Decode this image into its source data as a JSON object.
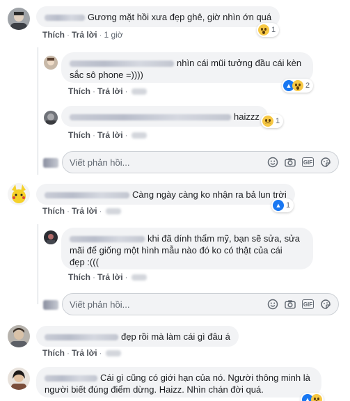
{
  "actions": {
    "like": "Thích",
    "reply": "Trả lời",
    "separator": "·"
  },
  "comments": [
    {
      "text": "Gương mặt hồi xưa đẹp ghê, giờ nhìn ớn quá",
      "time": "1 giờ",
      "reaction_count": "1",
      "reaction_types": [
        "wow-icon"
      ]
    },
    {
      "text_line1": "nhìn cái mũi tưởng đầu cái kèn",
      "text_line2": "sắc sô phone =))))",
      "reaction_count": "2",
      "reaction_types": [
        "like-icon",
        "wow-icon"
      ]
    },
    {
      "text": "haizzz",
      "reaction_count": "1",
      "reaction_types": [
        "sad-icon"
      ]
    },
    {
      "text": "Càng ngày càng ko nhận ra bả lun trời",
      "reaction_count": "1",
      "reaction_types": [
        "like-icon"
      ]
    },
    {
      "text_line1": "khi đã dính thẩm mỹ, bạn sẽ sửa, sửa",
      "text_line2": "mãi để giống một hình mẫu nào đó ko có thật của cái",
      "text_line3": "đẹp :((("
    },
    {
      "text": "đẹp rồi mà làm cái gì đâu á"
    },
    {
      "text_line1": "Cái gì cũng có giới hạn của nó. Người thông minh là",
      "text_line2": "người biết đúng điểm dừng. Haizz. Nhìn chán đời quá."
    }
  ],
  "reply_box": {
    "placeholder": "Viết phản hồi...",
    "gif_label": "GIF",
    "tools": [
      "emoji-icon",
      "camera-icon",
      "gif-icon",
      "sticker-icon"
    ]
  },
  "colors": {
    "bubble": "#f2f3f5",
    "link": "#4b4f56",
    "like_blue": "#1877f2",
    "emoji_yellow": "#f7c844"
  }
}
